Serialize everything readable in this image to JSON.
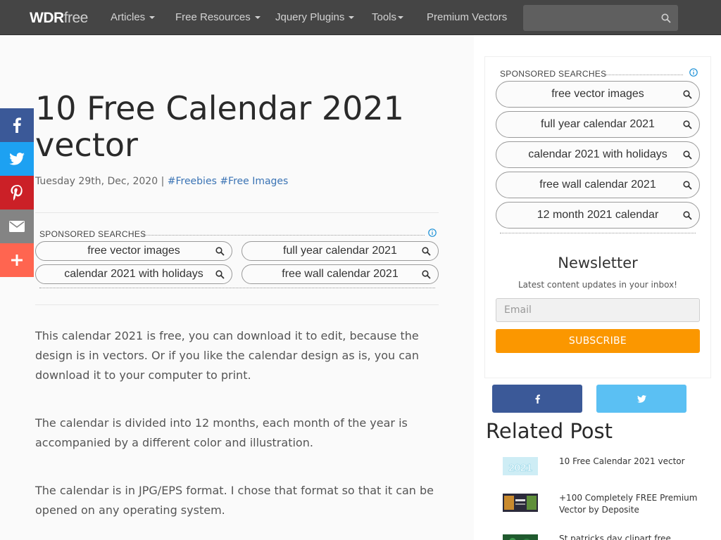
{
  "nav": {
    "logo_bold": "WDR",
    "logo_light": "free",
    "items": [
      {
        "label": "Articles",
        "dropdown": true
      },
      {
        "label": "Free Resources",
        "dropdown": true
      },
      {
        "label": "Jquery Plugins",
        "dropdown": true
      },
      {
        "label": "Tools",
        "dropdown": true
      },
      {
        "label": "Premium Vectors",
        "dropdown": false
      }
    ],
    "search_placeholder": ""
  },
  "share_bar": [
    {
      "icon": "facebook-icon",
      "color": "#3b5998"
    },
    {
      "icon": "twitter-icon",
      "color": "#1da1f2"
    },
    {
      "icon": "pinterest-icon",
      "color": "#cb2027"
    },
    {
      "icon": "email-icon",
      "color": "#848484"
    },
    {
      "icon": "plus-icon",
      "color": "#ff6550"
    }
  ],
  "post": {
    "title": "10 Free Calendar 2021 vector",
    "date": "Tuesday 29th, Dec, 2020",
    "separator": "|",
    "tags": [
      "#Freebies",
      "#Free Images"
    ],
    "paragraphs": [
      "This calendar 2021 is free, you can download it to edit, because the design is in vectors. Or if you like the calendar design as is, you can download it to your computer to print.",
      "The calendar is divided into 12 months, each month of the year is accompanied by a different color and illustration.",
      "The calendar is in JPG/EPS format. I chose that format so that it can be opened on any operating system."
    ]
  },
  "inline_sponsored": {
    "label": "SPONSORED SEARCHES",
    "items": [
      "free vector images",
      "full year calendar 2021",
      "calendar 2021 with holidays",
      "free wall calendar 2021"
    ]
  },
  "sidebar": {
    "sponsored": {
      "label": "SPONSORED SEARCHES",
      "items": [
        "free vector images",
        "full year calendar 2021",
        "calendar 2021 with holidays",
        "free wall calendar 2021",
        "12 month 2021 calendar"
      ]
    },
    "newsletter": {
      "title": "Newsletter",
      "subtitle": "Latest content updates in your inbox!",
      "email_placeholder": "Email",
      "subscribe_label": "SUBSCRIBE"
    },
    "social": [
      {
        "icon": "facebook-icon",
        "color": "#3b5998"
      },
      {
        "icon": "twitter-icon",
        "color": "#5bc0f3"
      }
    ],
    "related": {
      "title": "Related Post",
      "items": [
        {
          "title": "10 Free Calendar 2021 vector",
          "thumb_text": "2021"
        },
        {
          "title": "+100 Completely FREE Premium Vector by Deposite",
          "thumb_text": ""
        },
        {
          "title": "St patricks day clipart free",
          "thumb_text": ""
        }
      ]
    }
  },
  "colors": {
    "nav_bg": "#454545",
    "accent_orange": "#fb9700",
    "link_blue": "#3a73b4"
  }
}
